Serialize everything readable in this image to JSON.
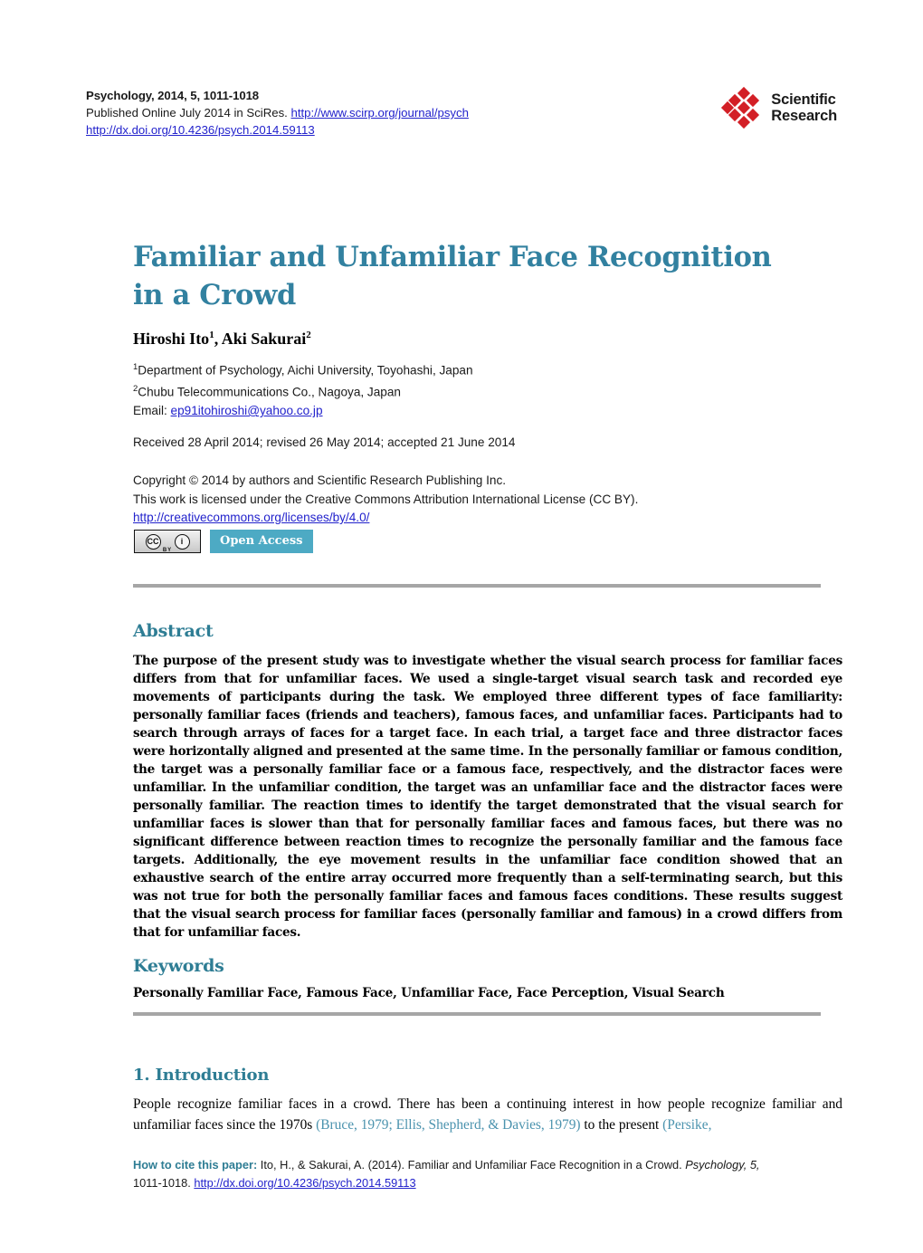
{
  "masthead": {
    "journal_line": "Psychology, 2014, 5, 1011-1018",
    "published_prefix": "Published Online July 2014 in SciRes. ",
    "published_url": "http://www.scirp.org/journal/psych",
    "doi_url": "http://dx.doi.org/10.4236/psych.2014.59113",
    "logo": {
      "line1": "Scientific",
      "line2": "Research",
      "mark_color": "#d31f26"
    }
  },
  "article": {
    "title_line1": "Familiar and Unfamiliar Face Recognition",
    "title_line2": "in a Crowd",
    "title_color": "#3281a0",
    "authors_plain": "Hiroshi Ito1, Aki Sakurai2",
    "author1_name": "Hiroshi Ito",
    "author1_sup": "1",
    "author_separator": ", ",
    "author2_name": "Aki Sakurai",
    "author2_sup": "2",
    "affiliation1_sup": "1",
    "affiliation1": "Department of Psychology, Aichi University, Toyohashi, Japan",
    "affiliation2_sup": "2",
    "affiliation2": "Chubu Telecommunications Co., Nagoya, Japan",
    "email_label": "Email: ",
    "email": "ep91itohiroshi@yahoo.co.jp",
    "dates": "Received 28 April 2014; revised 26 May 2014; accepted 21 June 2014",
    "copyright_line1": "Copyright © 2014 by authors and Scientific Research Publishing Inc.",
    "copyright_line2": "This work is licensed under the Creative Commons Attribution International License (CC BY).",
    "license_url": "http://creativecommons.org/licenses/by/4.0/"
  },
  "badges": {
    "cc_mark": "CC",
    "cc_info": "i",
    "cc_by": "BY",
    "open_access": "Open Access",
    "open_access_color": "#4daac4"
  },
  "sections": {
    "abstract_heading": "Abstract",
    "abstract_body": "The purpose of the present study was to investigate whether the visual search process for familiar faces differs from that for unfamiliar faces. We used a single-target visual search task and recorded eye movements of participants during the task. We employed three different types of face familiarity: personally familiar faces (friends and teachers), famous faces, and unfamiliar faces. Participants had to search through arrays of faces for a target face. In each trial, a target face and three distractor faces were horizontally aligned and presented at the same time. In the personally familiar or famous condition, the target was a personally familiar face or a famous face, respectively, and the distractor faces were unfamiliar. In the unfamiliar condition, the target was an unfamiliar face and the distractor faces were personally familiar. The reaction times to identify the target demonstrated that the visual search for unfamiliar faces is slower than that for personally familiar faces and famous faces, but there was no significant difference between reaction times to recognize the personally familiar and the famous face targets. Additionally, the eye movement results in the unfamiliar face condition showed that an exhaustive search of the entire array occurred more frequently than a self-terminating search, but this was not true for both the personally familiar faces and famous faces conditions. These results suggest that the visual search process for familiar faces (personally familiar and famous) in a crowd differs from that for unfamiliar faces.",
    "keywords_heading": "Keywords",
    "keywords_body": "Personally Familiar Face, Famous Face, Unfamiliar Face, Face Perception, Visual Search",
    "intro_heading": "1. Introduction",
    "intro_text_1": "People recognize familiar faces in a crowd. There has been a continuing interest in how people recognize familiar and unfamiliar faces since the 1970s ",
    "intro_citation_1": "(Bruce, 1979; Ellis, Shepherd, & Davies, 1979)",
    "intro_text_2": " to the present ",
    "intro_citation_2": "(Persike,",
    "citation_color": "#4b93ae"
  },
  "footer": {
    "label": "How to cite this paper:",
    "text_before_italic": " Ito, H., & Sakurai, A. (2014). Familiar and Unfamiliar Face Recognition in a Crowd. ",
    "journal_italic": "Psychology, 5,",
    "pages": "1011-1018. ",
    "doi_url": "http://dx.doi.org/10.4236/psych.2014.59113"
  }
}
